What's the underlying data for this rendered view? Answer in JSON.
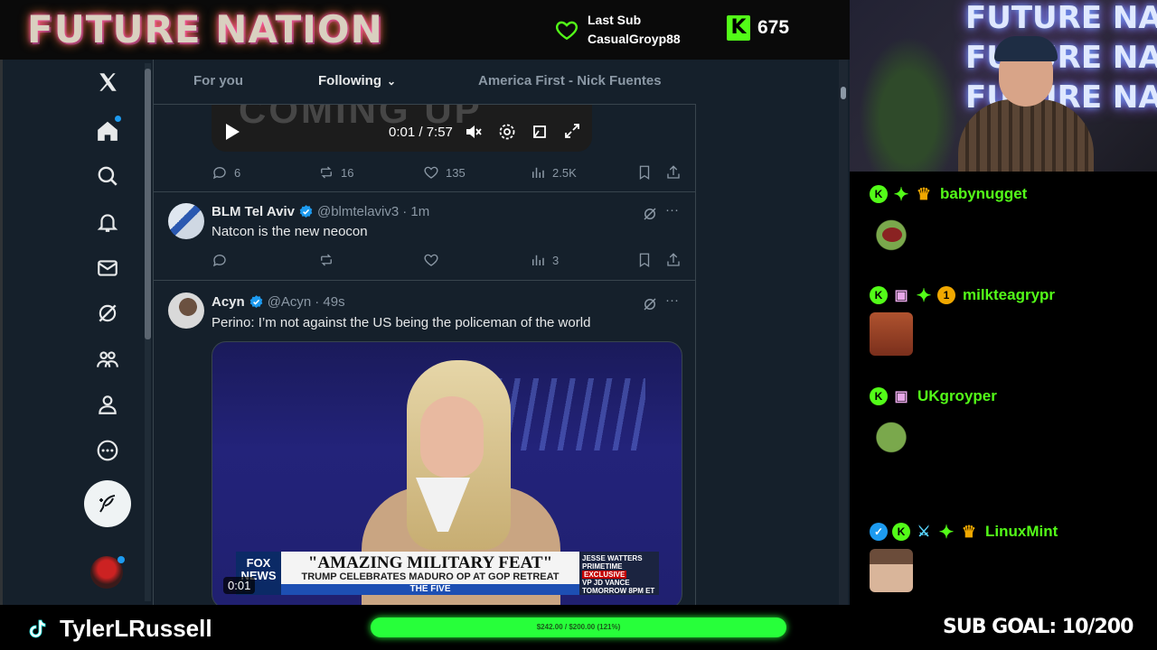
{
  "stream": {
    "brand": "FUTURE NATION",
    "last_sub_label": "Last Sub",
    "last_sub_user": "CasualGroyp88",
    "kick_badge": "K",
    "kick_count": "675",
    "streamer": "TylerLRussell",
    "goal_bar_text": "$242.00 / $200.00 (121%)",
    "goal_progress": 1.21,
    "sub_goal": "SUB GOAL: 10/200",
    "cam_neon": [
      "FUTURE NATION",
      "FUTURE NATION",
      "FUTURE NATION"
    ]
  },
  "x": {
    "tabs": [
      {
        "label": "For you",
        "active": false
      },
      {
        "label": "Following",
        "active": true
      },
      {
        "label": "America First - Nick Fuentes",
        "active": false
      }
    ],
    "video": {
      "overlay_text": "COMING UP",
      "time": "0:01 / 7:57"
    },
    "top_actions": {
      "replies": "6",
      "reposts": "16",
      "likes": "135",
      "views": "2.5K"
    },
    "posts": [
      {
        "name": "BLM Tel Aviv",
        "handle": "@blmtelaviv3",
        "time": "· 1m",
        "text": "Natcon is the new neocon",
        "views": "3"
      },
      {
        "name": "Acyn",
        "handle": "@Acyn",
        "time": "· 49s",
        "text": "Perino: I’m not against the US being the policeman of the world",
        "media": {
          "network": "FOX NEWS",
          "headline": "\"AMAZING MILITARY FEAT\"",
          "subhead": "TRUMP CELEBRATES MADURO OP AT GOP RETREAT",
          "show": "THE FIVE",
          "promo_title": "JESSE WATTERS PRIMETIME",
          "promo_tag": "EXCLUSIVE",
          "promo_guest": "VP JD VANCE",
          "promo_time": "TOMORROW 8PM ET",
          "timestamp": "0:01"
        }
      }
    ]
  },
  "chat": [
    {
      "user": "babynugget",
      "badges": [
        "kick",
        "sparkle",
        "crown"
      ],
      "emote": "pepe-scream"
    },
    {
      "user": "milkteagrypr",
      "badges": [
        "kick",
        "gift",
        "sparkle",
        "one"
      ],
      "emote": "face"
    },
    {
      "user": "UKgroyper",
      "badges": [
        "kick",
        "gift"
      ],
      "emote": "pepe-smug"
    },
    {
      "user": "LinuxMint",
      "badges": [
        "verified",
        "kick",
        "sword",
        "sparkle",
        "crown"
      ],
      "emote": "man"
    }
  ],
  "badge_glyphs": {
    "kick": "K",
    "one": "1"
  }
}
